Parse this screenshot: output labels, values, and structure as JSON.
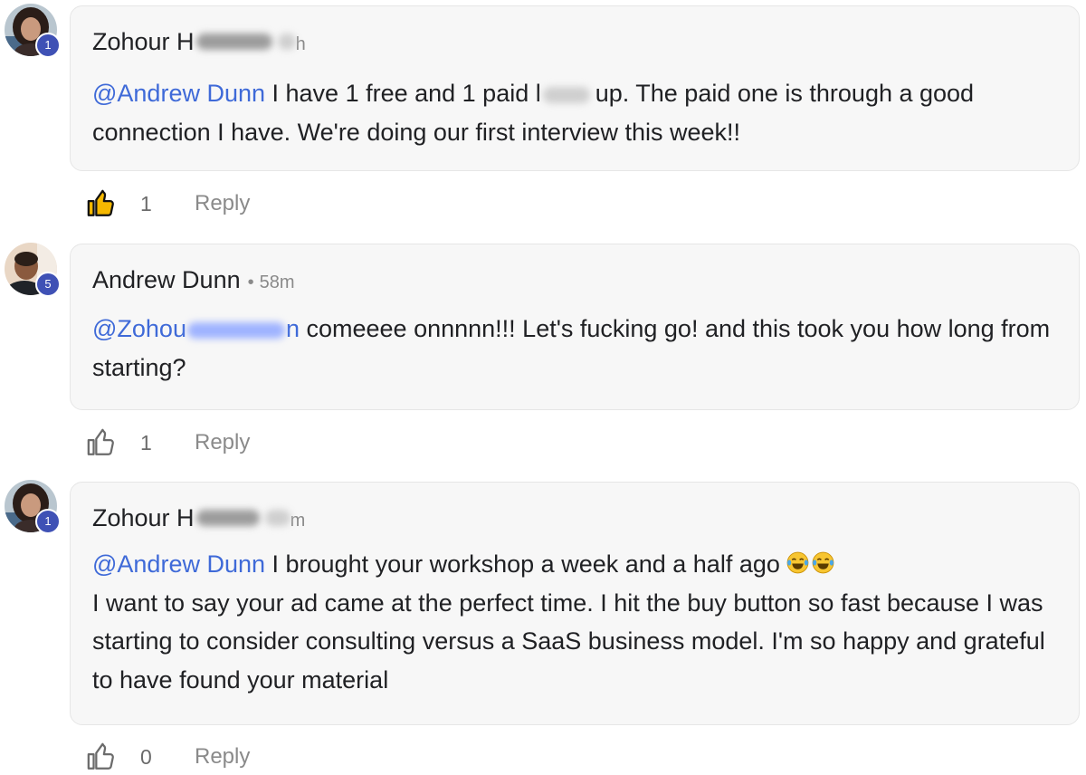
{
  "comments": [
    {
      "author": "Zohour H",
      "time_suffix": "h",
      "level": "1",
      "mention": "@Andrew Dunn",
      "text_before": " I have 1 free and 1 paid l",
      "text_after": "up. The paid one is through a good connection I have. We're doing our first interview this week!!",
      "like_count": "1",
      "reply_label": "Reply",
      "liked": true
    },
    {
      "author": "Andrew Dunn",
      "separator": "•",
      "time": "58m",
      "level": "5",
      "mention_start": "@Zohou",
      "mention_end": "n",
      "text": " comeeee onnnnn!!! Let's fucking go! and this took you how long from starting?",
      "like_count": "1",
      "reply_label": "Reply",
      "liked": false
    },
    {
      "author": "Zohour H",
      "time_suffix": "m",
      "level": "1",
      "mention": "@Andrew Dunn",
      "line1": " I brought your workshop a week and a half ago",
      "emoji": "😂😂",
      "paragraph2": "I want to say your ad came at the perfect time. I hit the buy button so fast because I was starting to consider consulting versus a SaaS business model. I'm so happy and grateful to have found your material",
      "like_count": "0",
      "reply_label": "Reply",
      "liked": false
    }
  ],
  "colors": {
    "mention": "#3f6ad8",
    "level_badge": "#3f51b5",
    "bubble_bg": "#f7f7f7",
    "liked_icon": "#f5b800"
  }
}
